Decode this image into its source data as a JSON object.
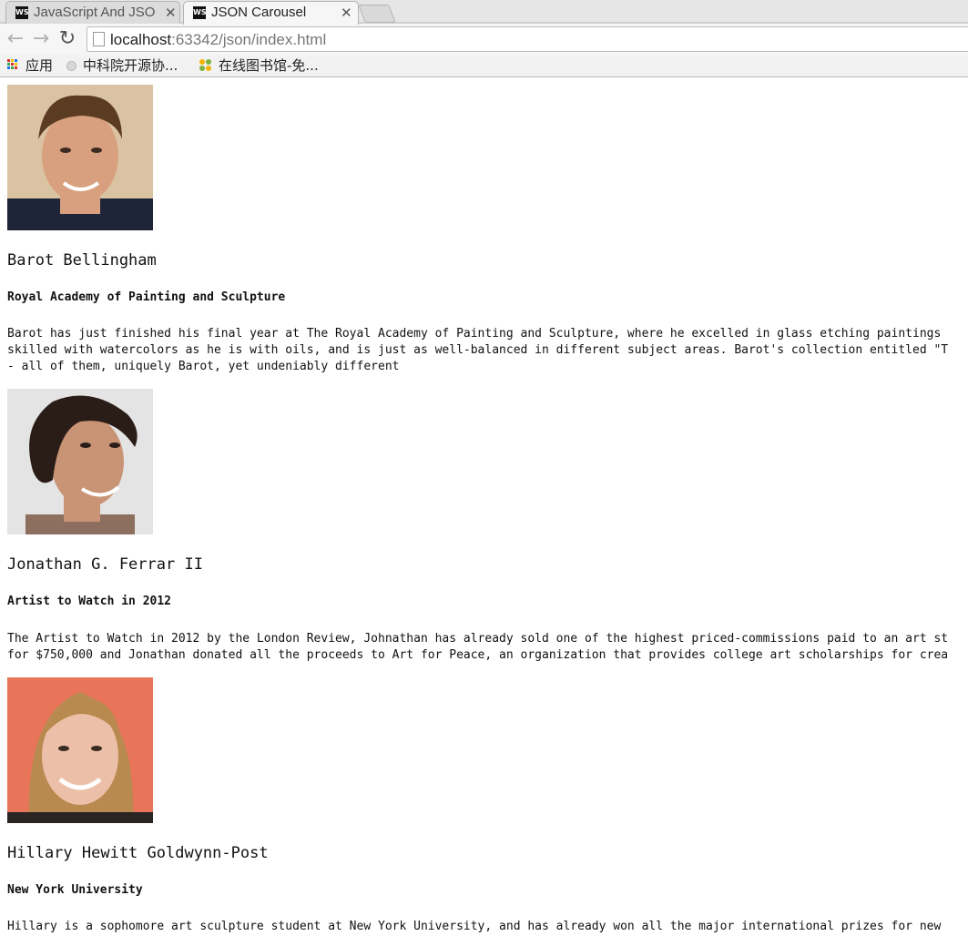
{
  "browser": {
    "tabs": [
      {
        "title": "JavaScript And JSO",
        "favicon": "WS",
        "active": false
      },
      {
        "title": "JSON Carousel",
        "favicon": "WS",
        "active": true
      }
    ],
    "address": {
      "host": "localhost",
      "path": ":63342/json/index.html"
    },
    "bookmarks": [
      {
        "label": "应用",
        "icon": "apps-grid-icon"
      },
      {
        "label": "中科院开源协...",
        "icon": "globe-dot-icon"
      },
      {
        "label": "在线图书馆-免...",
        "icon": "clover-icon"
      }
    ]
  },
  "people": [
    {
      "name": "Barot Bellingham",
      "reknown": "Royal Academy of Painting and Sculpture",
      "bio_lines": [
        "Barot has just finished his final year at The Royal Academy of Painting and Sculpture, where he excelled in glass etching paintings",
        "skilled with watercolors as he is with oils, and is just as well-balanced in different subject areas. Barot's collection entitled \"T",
        "- all of them, uniquely Barot, yet undeniably different"
      ],
      "photo": {
        "bg": "#d9c3a2",
        "skin": "#d8a07e",
        "hair": "#5b3b22",
        "shirt": "#1f2538"
      }
    },
    {
      "name": "Jonathan G. Ferrar II",
      "reknown": "Artist to Watch in 2012",
      "bio_lines": [
        "The Artist to Watch in 2012 by the London Review, Johnathan has already sold one of the highest priced-commissions paid to an art st",
        "for $750,000 and Jonathan donated all the proceeds to Art for Peace, an organization that provides college art scholarships for crea"
      ],
      "photo": {
        "bg": "#e4e4e4",
        "skin": "#c99475",
        "hair": "#2a1d17",
        "shirt": "#8c6f5e"
      }
    },
    {
      "name": "Hillary Hewitt Goldwynn-Post",
      "reknown": "New York University",
      "bio_lines": [
        "Hillary is a sophomore art sculpture student at New York University, and has already won all the major international prizes for new"
      ],
      "photo": {
        "bg": "#e8745a",
        "skin": "#ecc0a8",
        "hair": "#b98a50",
        "shirt": "#2a2422"
      }
    }
  ]
}
